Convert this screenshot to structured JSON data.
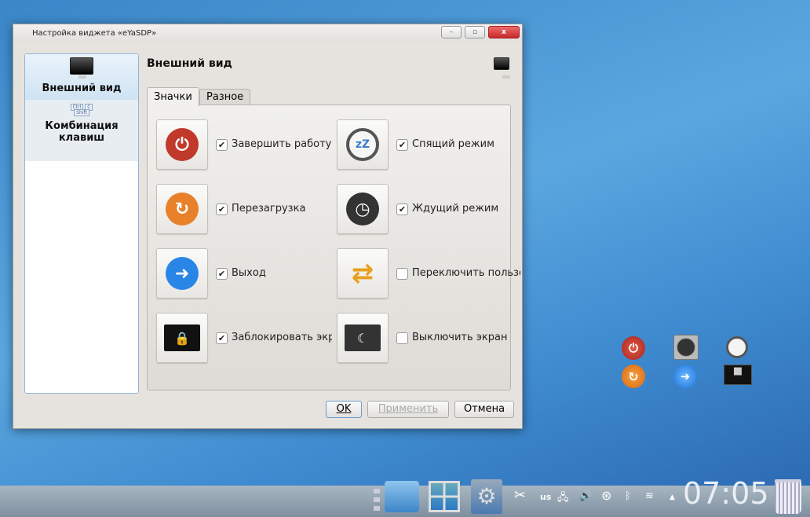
{
  "window": {
    "title": "Настройка виджета «eYaSDP»",
    "min": "–",
    "max": "▫",
    "close": "x"
  },
  "sidebar": {
    "items": [
      {
        "label": "Внешний вид",
        "selected": true
      },
      {
        "label": "Комбинация клавиш",
        "selected": false
      }
    ],
    "keys": [
      "Ctrl",
      "C",
      "Shift"
    ]
  },
  "page": {
    "heading": "Внешний вид"
  },
  "tabs": [
    {
      "label": "Значки",
      "active": true
    },
    {
      "label": "Разное",
      "active": false
    }
  ],
  "options": [
    {
      "label": "Завершить работу",
      "checked": true,
      "icon": "power-icon",
      "glyph": "⏻",
      "color": "#c0392b"
    },
    {
      "label": "Спящий режим",
      "checked": true,
      "icon": "sleep-clock-icon",
      "glyph": "zZ",
      "color": "#555"
    },
    {
      "label": "Перезагрузка",
      "checked": true,
      "icon": "restart-icon",
      "glyph": "↻",
      "color": "#e8812a"
    },
    {
      "label": "Ждущий режим",
      "checked": true,
      "icon": "clock-icon",
      "glyph": "◷",
      "color": "#333"
    },
    {
      "label": "Выход",
      "checked": true,
      "icon": "logout-icon",
      "glyph": "➜",
      "color": "#2a86e6"
    },
    {
      "label": "Переключить пользователя",
      "checked": false,
      "icon": "switch-user-icon",
      "glyph": "⇄",
      "color": "#e8a020"
    },
    {
      "label": "Заблокировать экран",
      "checked": true,
      "icon": "lock-screen-icon",
      "glyph": "🔒",
      "color": "#111"
    },
    {
      "label": "Выключить экран",
      "checked": false,
      "icon": "screen-off-icon",
      "glyph": "☾",
      "color": "#333"
    }
  ],
  "buttons": {
    "ok": "OK",
    "apply": "Применить",
    "cancel": "Отмена"
  },
  "tray": {
    "layout": "us",
    "clock": "07:05"
  }
}
